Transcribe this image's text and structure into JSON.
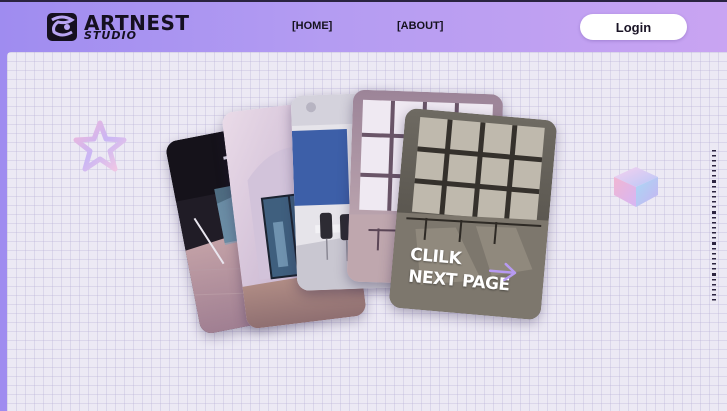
{
  "brand": {
    "name": "ARTNEST",
    "sub": "STUDIO",
    "logo_icon": "artnest-logo-icon"
  },
  "nav": {
    "home_label": "[HOME]",
    "about_label": "[ABOUT]"
  },
  "header": {
    "login_label": "Login"
  },
  "gallery": {
    "cards": [
      {
        "name": "office-corridor-image"
      },
      {
        "name": "arched-window-image"
      },
      {
        "name": "meeting-room-image"
      },
      {
        "name": "bright-window-room-image"
      },
      {
        "name": "next-page-card"
      }
    ],
    "cta_line1": "CLILK",
    "cta_line2": "NEXT PAGE",
    "cta_icon": "arrow-right-icon"
  },
  "colors": {
    "header_gradient_start": "#9f8cf0",
    "header_gradient_end": "#c9a4f2",
    "canvas": "#ece9f4",
    "login_bg": "#ffffff",
    "accent": "#a98ae8"
  }
}
